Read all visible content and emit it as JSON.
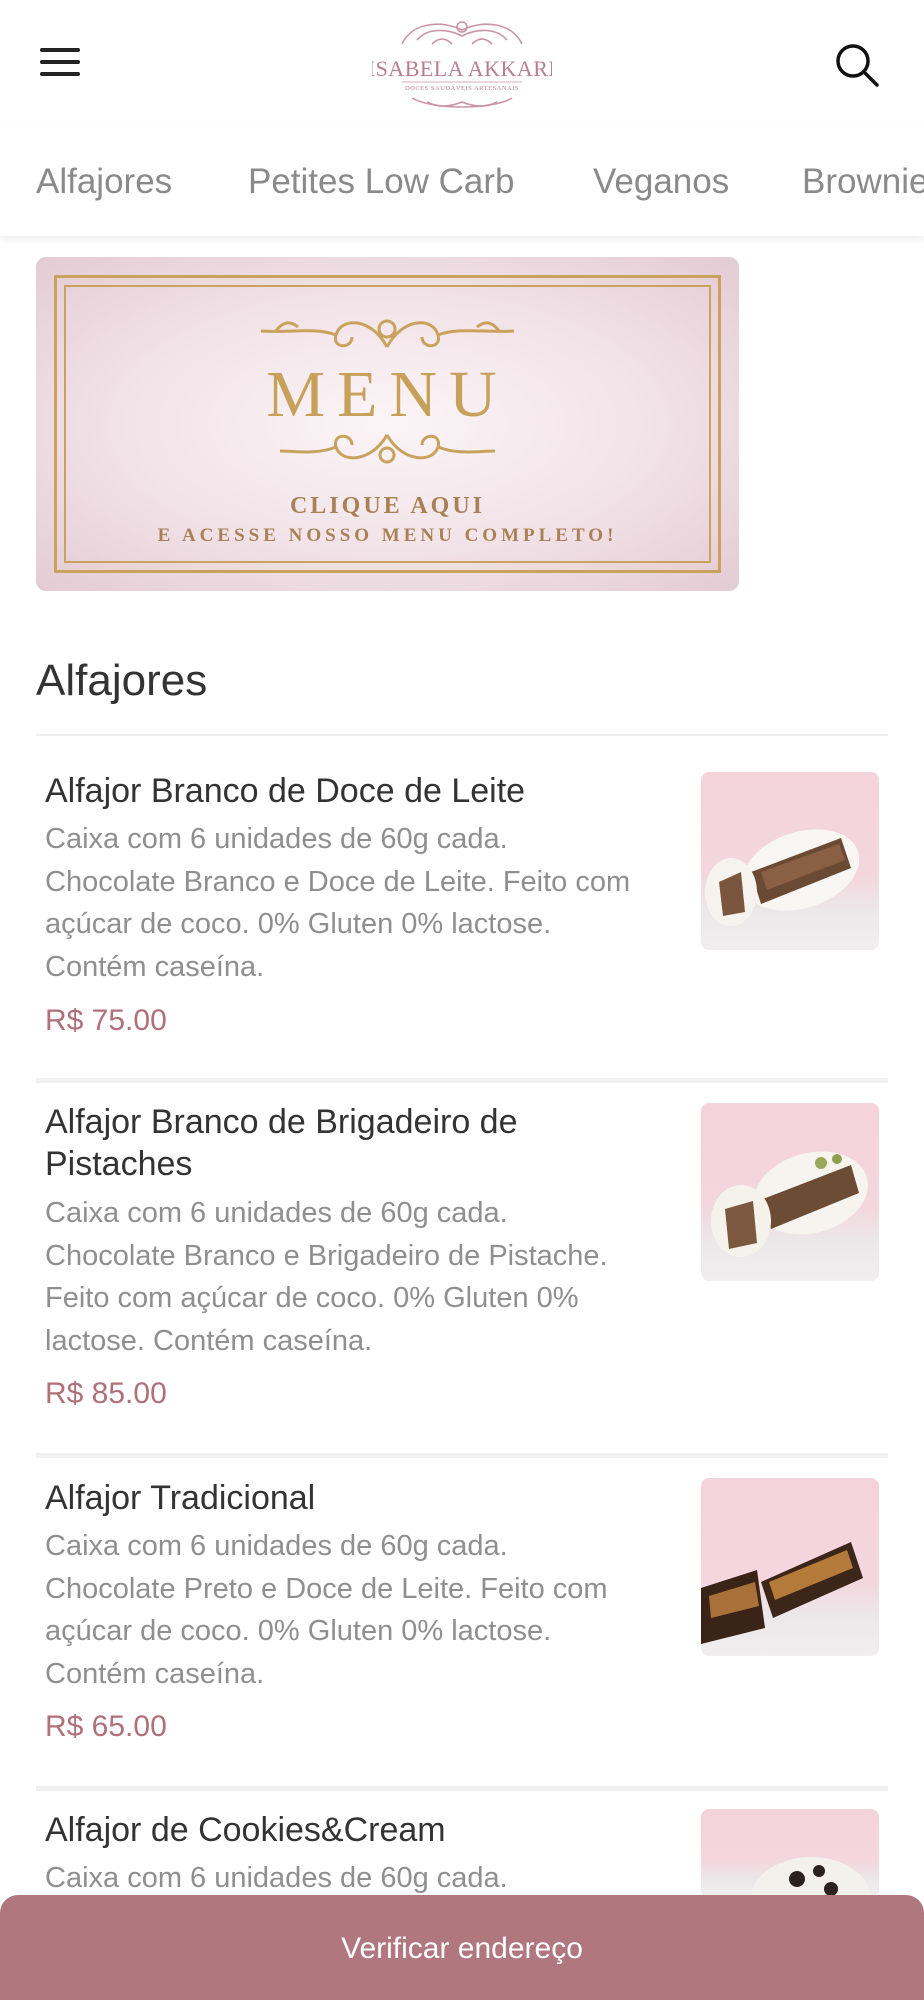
{
  "header": {
    "logo_name": "ISABELA AKKARI",
    "logo_tagline": "DOCES SAUDÁVEIS ARTESANAIS",
    "menu_icon": "hamburger-menu-icon",
    "search_icon": "search-icon"
  },
  "tabs": [
    "Alfajores",
    "Petites Low Carb",
    "Veganos",
    "Brownie"
  ],
  "banner": {
    "title": "MENU",
    "line1": "CLIQUE AQUI",
    "line2": "E ACESSE NOSSO MENU COMPLETO!"
  },
  "section": {
    "title": "Alfajores"
  },
  "products": [
    {
      "name": "Alfajor Branco de Doce de Leite",
      "description_lines": [
        "Caixa com 6 unidades de 60g cada.",
        "Chocolate Branco e Doce de Leite. Feito com",
        "açúcar de coco. 0% Gluten 0% lactose.",
        "Contém caseína."
      ],
      "price": "R$ 75.00",
      "image": "white-chocolate-alfajor"
    },
    {
      "name_lines": [
        "Alfajor Branco de Brigadeiro de",
        "Pistaches"
      ],
      "description_lines": [
        "Caixa com 6 unidades de 60g cada.",
        "Chocolate Branco e Brigadeiro de Pistache.",
        "Feito com açúcar de coco. 0% Gluten 0%",
        "lactose. Contém caseína."
      ],
      "price": "R$ 85.00",
      "image": "pistachio-alfajor"
    },
    {
      "name": "Alfajor Tradicional",
      "description_lines": [
        "Caixa com 6 unidades de 60g cada.",
        "Chocolate Preto e Doce de Leite. Feito com",
        "açúcar de coco. 0% Gluten 0% lactose.",
        "Contém caseína."
      ],
      "price": "R$ 65.00",
      "image": "dark-chocolate-alfajor"
    },
    {
      "name": "Alfajor de Cookies&Cream",
      "description_lines": [
        "Caixa com 6 unidades de 60g cada."
      ],
      "image": "cookies-cream-alfajor"
    }
  ],
  "bottom_bar": {
    "label": "Verificar endereço"
  },
  "colors": {
    "accent": "#b0777f",
    "price": "#b0707a",
    "gold": "#c9a25d"
  }
}
